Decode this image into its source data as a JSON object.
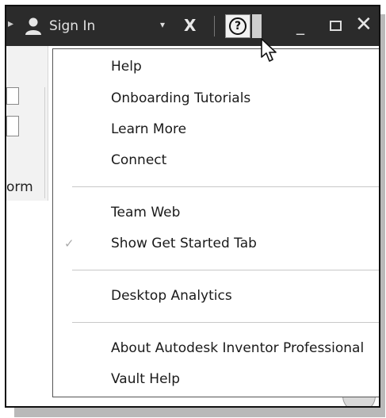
{
  "titlebar": {
    "signin_label": "Sign In",
    "help_symbol": "?",
    "x_logo": "X"
  },
  "ribbon": {
    "label_fragment": "orm"
  },
  "menu": {
    "groups": [
      {
        "items": [
          {
            "label": "Help",
            "checked": false
          },
          {
            "label": "Onboarding Tutorials",
            "checked": false
          },
          {
            "label": "Learn More",
            "checked": false
          },
          {
            "label": "Connect",
            "checked": false
          }
        ]
      },
      {
        "items": [
          {
            "label": "Team Web",
            "checked": false
          },
          {
            "label": "Show Get Started Tab",
            "checked": true
          }
        ]
      },
      {
        "items": [
          {
            "label": "Desktop Analytics",
            "checked": false
          }
        ]
      },
      {
        "items": [
          {
            "label": "About Autodesk Inventor Professional",
            "checked": false
          },
          {
            "label": "Vault Help",
            "checked": false
          }
        ]
      }
    ],
    "check_glyph": "✓"
  },
  "colors": {
    "titlebar_bg": "#2b2b2b",
    "menu_bg": "#ffffff",
    "separator": "#c8c8c8"
  }
}
